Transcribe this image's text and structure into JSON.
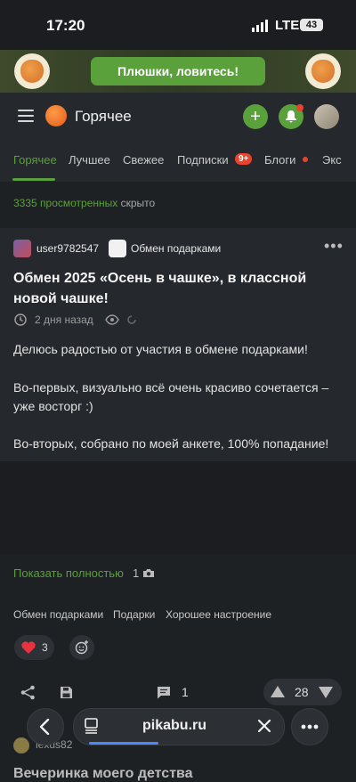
{
  "status": {
    "time": "17:20",
    "network": "LTE",
    "battery": "43"
  },
  "promo": {
    "button_label": "Плюшки, ловитесь!"
  },
  "header": {
    "title": "Горячее",
    "add_symbol": "+"
  },
  "tabs": [
    {
      "label": "Горячее",
      "active": true
    },
    {
      "label": "Лучшее"
    },
    {
      "label": "Свежее"
    },
    {
      "label": "Подписки"
    },
    {
      "label": "Блоги"
    },
    {
      "label": "Экс"
    }
  ],
  "subscriptions_badge": "9+",
  "hidden": {
    "count": "3335 просмотренных",
    "suffix": "скрыто"
  },
  "post": {
    "author": "user9782547",
    "community": "Обмен подарками",
    "title": "Обмен 2025 «Осень в чашке», в классной новой чашке!",
    "time": "2 дня назад",
    "paragraphs": [
      "Делюсь радостью от участия в обмене подарками!",
      "Во-первых, визуально всё очень красиво сочетается – уже восторг :)",
      "Во-вторых, собрано по моей анкете, 100% попадание!"
    ],
    "show_full": "Показать полностью",
    "photo_count": "1",
    "tags": [
      "Обмен подарками",
      "Подарки",
      "Хорошее настроение"
    ],
    "likes": "3",
    "comments": "1",
    "rating": "28"
  },
  "browser": {
    "url": "pikabu.ru"
  },
  "next_post": {
    "author": "lexus82",
    "title": "Вечеринка моего детства"
  },
  "colors": {
    "accent": "#5aa03b",
    "alert": "#e8432f",
    "background": "#1e2124"
  }
}
